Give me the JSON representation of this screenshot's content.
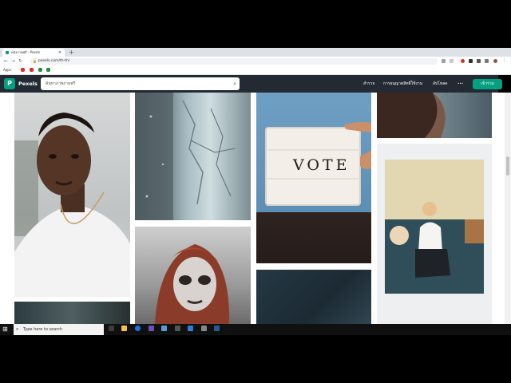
{
  "browser": {
    "tab_title": "คลังภาพฟรี - Pexels",
    "tab_close": "×",
    "new_tab": "+",
    "url": "pexels.com/th-th/",
    "back": "←",
    "forward": "→",
    "reload": "↻",
    "home": "⌂",
    "bookmarks_apps": "Apps"
  },
  "header": {
    "brand": "Pexels",
    "logo_letter": "P",
    "search_placeholder": "ค้นหาภาพถ่ายฟรี",
    "nav": [
      "สำรวจ",
      "การอนุญาตสิทธิ์ใช้งาน",
      "อัปโหลด",
      "•••"
    ],
    "join_label": "เข้าร่วม"
  },
  "photos": [
    {
      "name": "portrait-man-white-tshirt"
    },
    {
      "name": "frozen-ice-texture"
    },
    {
      "name": "vote-lightbox-sign",
      "sign_text": "VOTE"
    },
    {
      "name": "woman-dark-hair-partial"
    },
    {
      "name": "polaroid-woman-sofa"
    },
    {
      "name": "zombie-makeup-woman"
    },
    {
      "name": "dark-teal-abstract"
    },
    {
      "name": "dark-photo-bottom-left"
    }
  ],
  "taskbar": {
    "search_placeholder": "Type here to search"
  },
  "colors": {
    "pexels_green": "#05a081",
    "header_bg": "#232a34"
  }
}
